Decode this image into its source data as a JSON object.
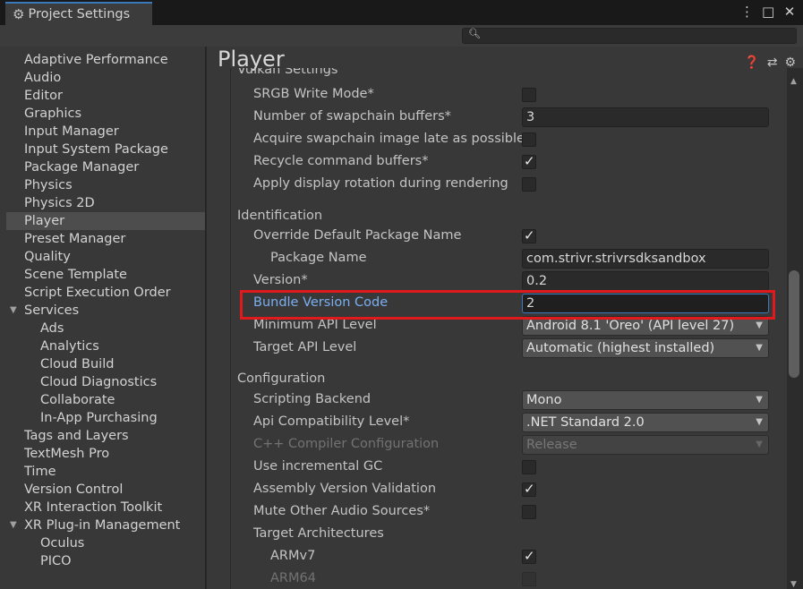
{
  "window": {
    "tab_title": "Project Settings",
    "controls": [
      "⋮",
      "□",
      "✕"
    ]
  },
  "search": {
    "placeholder": ""
  },
  "sidebar": {
    "items": [
      {
        "label": "Adaptive Performance",
        "level": 0
      },
      {
        "label": "Audio",
        "level": 0
      },
      {
        "label": "Editor",
        "level": 0
      },
      {
        "label": "Graphics",
        "level": 0
      },
      {
        "label": "Input Manager",
        "level": 0
      },
      {
        "label": "Input System Package",
        "level": 0
      },
      {
        "label": "Package Manager",
        "level": 0
      },
      {
        "label": "Physics",
        "level": 0
      },
      {
        "label": "Physics 2D",
        "level": 0
      },
      {
        "label": "Player",
        "level": 0,
        "selected": true
      },
      {
        "label": "Preset Manager",
        "level": 0
      },
      {
        "label": "Quality",
        "level": 0
      },
      {
        "label": "Scene Template",
        "level": 0
      },
      {
        "label": "Script Execution Order",
        "level": 0
      },
      {
        "label": "Services",
        "level": 0,
        "expanded": true
      },
      {
        "label": "Ads",
        "level": 1
      },
      {
        "label": "Analytics",
        "level": 1
      },
      {
        "label": "Cloud Build",
        "level": 1
      },
      {
        "label": "Cloud Diagnostics",
        "level": 1
      },
      {
        "label": "Collaborate",
        "level": 1
      },
      {
        "label": "In-App Purchasing",
        "level": 1
      },
      {
        "label": "Tags and Layers",
        "level": 0
      },
      {
        "label": "TextMesh Pro",
        "level": 0
      },
      {
        "label": "Time",
        "level": 0
      },
      {
        "label": "Version Control",
        "level": 0
      },
      {
        "label": "XR Interaction Toolkit",
        "level": 0
      },
      {
        "label": "XR Plug-in Management",
        "level": 0,
        "expanded": true
      },
      {
        "label": "Oculus",
        "level": 1
      },
      {
        "label": "PICO",
        "level": 1
      }
    ]
  },
  "main": {
    "title": "Player",
    "clipped_section": "Vulkan Settings",
    "vulkan": {
      "srgb_write_mode": {
        "label": "SRGB Write Mode*",
        "checked": false
      },
      "swapchain_buffers": {
        "label": "Number of swapchain buffers*",
        "value": "3"
      },
      "acquire_late": {
        "label": "Acquire swapchain image late as possible*",
        "checked": false
      },
      "recycle_buffers": {
        "label": "Recycle command buffers*",
        "checked": true
      },
      "display_rotation": {
        "label": "Apply display rotation during rendering",
        "checked": false
      }
    },
    "identification": {
      "header": "Identification",
      "override_package": {
        "label": "Override Default Package Name",
        "checked": true
      },
      "package_name": {
        "label": "Package Name",
        "value": "com.strivr.strivrsdksandbox"
      },
      "version": {
        "label": "Version*",
        "value": "0.2"
      },
      "bundle_version_code": {
        "label": "Bundle Version Code",
        "value": "2"
      },
      "min_api": {
        "label": "Minimum API Level",
        "value": "Android 8.1 'Oreo' (API level 27)"
      },
      "target_api": {
        "label": "Target API Level",
        "value": "Automatic (highest installed)"
      }
    },
    "configuration": {
      "header": "Configuration",
      "scripting_backend": {
        "label": "Scripting Backend",
        "value": "Mono"
      },
      "api_compat": {
        "label": "Api Compatibility Level*",
        "value": ".NET Standard 2.0"
      },
      "cpp_compiler": {
        "label": "C++ Compiler Configuration",
        "value": "Release"
      },
      "incremental_gc": {
        "label": "Use incremental GC",
        "checked": false
      },
      "assembly_validation": {
        "label": "Assembly Version Validation",
        "checked": true
      },
      "mute_audio": {
        "label": "Mute Other Audio Sources*",
        "checked": false
      },
      "target_arch": {
        "label": "Target Architectures"
      },
      "armv7": {
        "label": "ARMv7",
        "checked": true
      },
      "arm64": {
        "label": "ARM64",
        "checked": false
      }
    }
  },
  "colors": {
    "accent": "#3a79bb",
    "highlight_box": "#e0191c",
    "highlight_label": "#7aaef0"
  }
}
